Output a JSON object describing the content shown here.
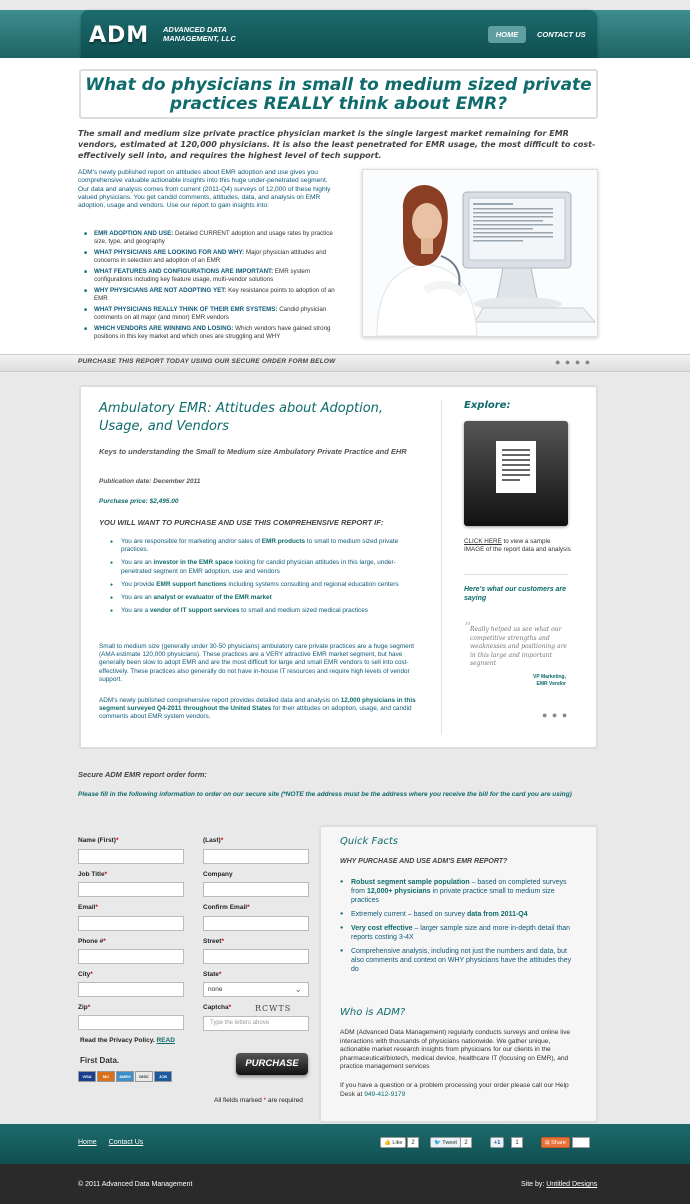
{
  "header": {
    "logo": "ADM",
    "logo_sub": "ADVANCED DATA MANAGEMENT, LLC",
    "nav_home": "HOME",
    "nav_contact": "CONTACT US"
  },
  "hero": {
    "headline": "What do physicians in small to medium sized private practices REALLY think about EMR?",
    "intro_bold": "The small and medium size private practice physician market is the single largest market remaining for EMR vendors, estimated at 120,000 physicians. It is also the least penetrated for EMR usage, the most difficult to cost-effectively sell into, and requires the highest level of tech support.",
    "intro_text": "ADM's newly published report on attitudes about EMR adoption and use gives you comprehensive valuable actionable insights into this huge under-penetrated segment. Our data and analysis comes from current (2011-Q4) surveys of 12,000 of these highly valued physicians. You get candid comments, attitudes, data, and analysis on EMR adoption, usage and vendors. Use our report to gain insights into:",
    "bullets": [
      {
        "title": "EMR ADOPTION AND USE:",
        "text": " Detailed CURRENT adoption and usage rates by practice size, type, and geography"
      },
      {
        "title": "WHAT PHYSICIANS ARE LOOKING FOR AND WHY:",
        "text": " Major physician attitudes and concerns in selection and adoption of an EMR"
      },
      {
        "title": "WHAT FEATURES AND CONFIGURATIONS ARE IMPORTANT:",
        "text": " EMR system configurations including key feature usage, multi-vendor solutions"
      },
      {
        "title": "WHY PHYSICIANS ARE NOT ADOPTING YET:",
        "text": " Key resistance points to adoption of an EMR"
      },
      {
        "title": "WHAT PHYSICIANS REALLY THINK OF THEIR EMR SYSTEMS:",
        "text": " Candid physician comments on all major (and minor) EMR vendors"
      },
      {
        "title": "WHICH VENDORS ARE WINNING AND LOSING:",
        "text": " Which vendors have gained strong positions in this key market and which ones are struggling and WHY"
      }
    ],
    "cta": "PURCHASE THIS REPORT TODAY USING OUR SECURE ORDER FORM BELOW"
  },
  "report": {
    "title": "Ambulatory EMR: Attitudes about Adoption, Usage, and Vendors",
    "subtitle": "Keys to understanding the Small to Medium size Ambulatory Private Practice and EHR",
    "pub_date": "Publication date: December 2011",
    "price": "Purchase price: $2,495.00",
    "want_title": "YOU WILL WANT TO PURCHASE AND USE THIS COMPREHENSIVE REPORT IF:",
    "want_items": [
      {
        "pre": "You are responsible for marketing and/or sales of ",
        "bold": "EMR products",
        "post": " to small to medium sized private practices."
      },
      {
        "pre": "You are an ",
        "bold": "investor in the EMR space",
        "post": " looking for candid physician attitudes in this large, under-penetrated segment on EMR adoption, use and vendors"
      },
      {
        "pre": "You provide ",
        "bold": "EMR support functions",
        "post": " including systems consulting and regional education centers"
      },
      {
        "pre": "You are an ",
        "bold": "analyst or evaluator of the EMR market",
        "post": ""
      },
      {
        "pre": "You are a ",
        "bold": "vendor of IT support services",
        "post": " to small and medium sized medical practices"
      }
    ],
    "para1": "Small to medium size (generally under 30-50 physicians) ambulatory care private practices are a huge segment (AMA estimate 120,000 physicians). These practices are a VERY attractive EMR market segment, but have generally been slow to adopt EMR and are the most difficult for large and small EMR vendors to sell into cost-effectively. These practices also generally do not have in-house IT resources and require high levels of vendor support.",
    "para2_pre": "ADM's newly published comprehensive report provides detailed data and analysis on ",
    "para2_bold": "12,000 physicians in this segment surveyed Q4-2011 throughout the United States",
    "para2_post": " for their attitudes on adoption, usage, and candid comments about EMR system vendors.",
    "explore": "Explore:",
    "click_here": "CLICK HERE",
    "sample_text": " to view a sample IMAGE of the report data and analysis",
    "customers": "Here's what our customers are saying",
    "quote": "Really helped us see what our competitive strengths and weaknesses and positioning are in this large and important segment",
    "quote_by_1": "VP Marketing,",
    "quote_by_2": "EMR Vendor"
  },
  "order": {
    "title": "Secure ADM EMR report order form:",
    "note": "Please fill in the following information to order on our secure site (*NOTE the address must be the address where you receive the bill for the card you are using)",
    "fields": {
      "first": "Name (First)",
      "last": "(Last)",
      "job": "Job Title",
      "company": "Company",
      "email": "Email",
      "confirm": "Confirm Email",
      "phone": "Phone #",
      "street": "Street",
      "city": "City",
      "state": "State",
      "zip": "Zip",
      "captcha": "Captcha"
    },
    "state_value": "none",
    "captcha_text": "RCWTS",
    "captcha_placeholder": "Type the letters above",
    "privacy": "Read the Privacy Policy.",
    "privacy_link": "READ",
    "firstdata": "First Data.",
    "cards": [
      "VISA",
      "MC",
      "AMEX",
      "DISC",
      "JCB"
    ],
    "purchase": "PURCHASE",
    "required_pre": "All fields marked ",
    "required_post": " are required"
  },
  "facts": {
    "title": "Quick Facts",
    "subtitle": "WHY PURCHASE AND USE ADM'S EMR REPORT?",
    "items": [
      {
        "bold": "Robust segment sample population",
        "text": " – based on completed surveys from ",
        "bold2": "12,000+ physicians",
        "text2": " in private practice small to medium size practices"
      },
      {
        "bold": "",
        "text": "Extremely current – based on survey ",
        "bold2": "data from 2011-Q4",
        "text2": ""
      },
      {
        "bold": "Very cost effective",
        "text": " – larger sample size and more in-depth detail than reports costing 3-4X",
        "bold2": "",
        "text2": ""
      },
      {
        "bold": "",
        "text": "Comprehensive analysis, including not just the numbers and data, but also comments and context on WHY physicians have the attitudes they do",
        "bold2": "",
        "text2": ""
      }
    ],
    "who_title": "Who is ADM?",
    "who_text": "ADM (Advanced Data Management) regularly conducts surveys and online live interactions with thousands of physicians nationwide. We gather unique, actionable market research insights from physicians for our clients in the pharmaceutical/biotech, medical device, healthcare IT (focusing on EMR), and practice management services",
    "help_text": "If you have a question or a problem processing your order please call our Help Desk at ",
    "phone": "949-412-9179"
  },
  "footer": {
    "home": "Home",
    "contact": "Contact Us",
    "like": "Like",
    "like_count": "2",
    "tweet": "Tweet",
    "tweet_count": "2",
    "plus": "+1",
    "plus_count": "1",
    "share": "Share",
    "copyright": "© 2011 Advanced Data Management",
    "siteby_pre": "Site by: ",
    "siteby_link": "Untitled Designs"
  }
}
